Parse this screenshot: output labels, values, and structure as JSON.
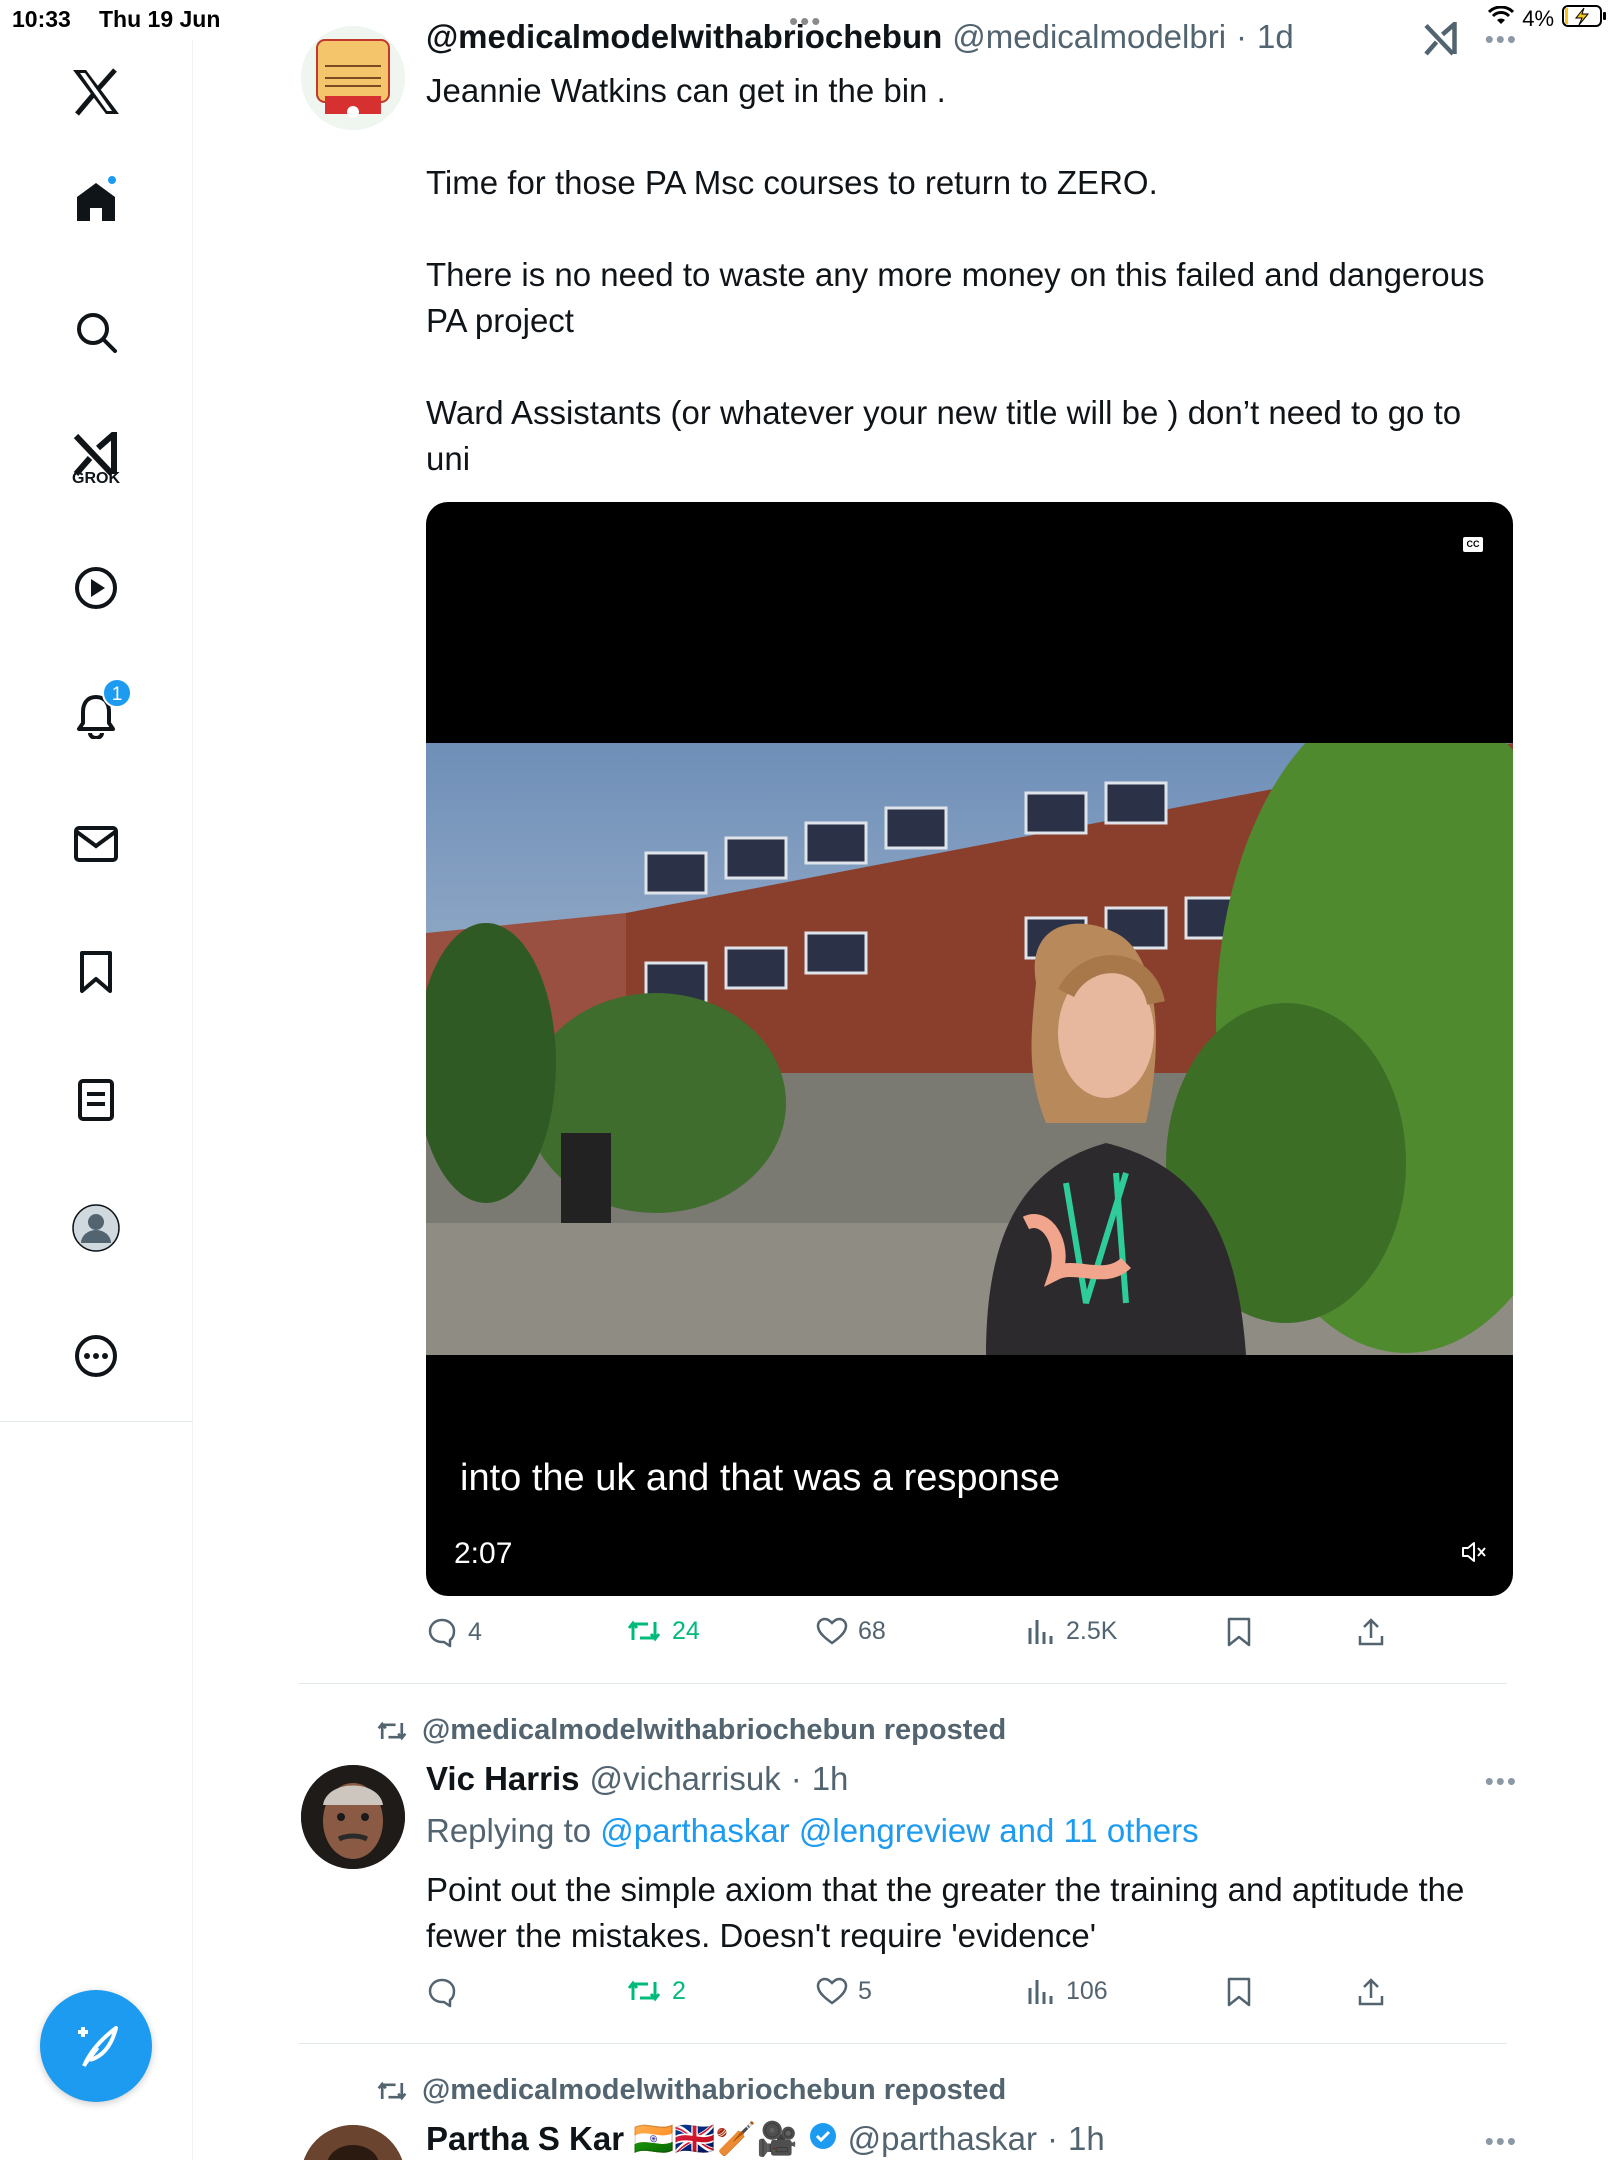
{
  "status_bar": {
    "time": "10:33",
    "date": "Thu 19 Jun",
    "battery_percent": "4%"
  },
  "sidebar": {
    "grok_label": "GROK",
    "notifications_badge": "1",
    "accent_color": "#1d9bf0"
  },
  "tweets": [
    {
      "display_name": "@medicalmodelwithabriochebun",
      "handle": "@medicalmodelbri",
      "separator": "·",
      "time": "1d",
      "text": [
        "Jeannie Watkins can get in the bin .",
        "Time for those PA Msc courses to return to ZERO.",
        "There is no need to waste any more money on this failed and dangerous PA project",
        "Ward Assistants (or whatever your new title will be ) don’t need to go to uni"
      ],
      "video": {
        "caption": "into the uk and that was a response",
        "duration": "2:07",
        "cc_label": "CC"
      },
      "stats": {
        "replies": "4",
        "reposts": "24",
        "likes": "68",
        "views": "2.5K"
      }
    },
    {
      "repost_label": "@medicalmodelwithabriochebun reposted",
      "display_name": "Vic Harris",
      "handle": "@vicharrisuk",
      "separator": "·",
      "time": "1h",
      "reply_prefix": "Replying to",
      "reply_targets": "@parthaskar @lengreview and 11 others",
      "text": "Point out the simple axiom that the greater the training and aptitude the fewer the mistakes. Doesn't require 'evidence'",
      "stats": {
        "replies": "",
        "reposts": "2",
        "likes": "5",
        "views": "106"
      }
    },
    {
      "repost_label": "@medicalmodelwithabriochebun reposted",
      "display_name": "Partha S Kar 🇮🇳🇬🇧🏏🎥",
      "handle": "@parthaskar",
      "separator": "·",
      "time": "1h"
    }
  ]
}
